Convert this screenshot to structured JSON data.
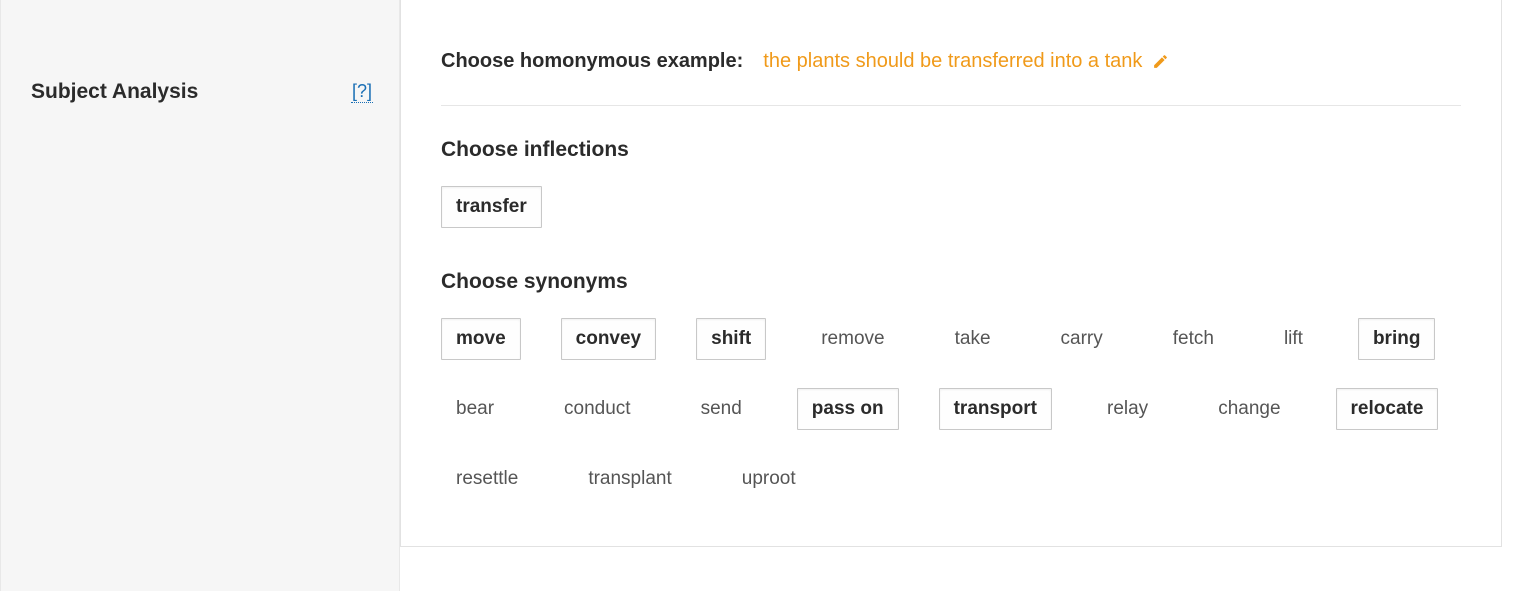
{
  "sidebar": {
    "title": "Subject Analysis",
    "help_label": "[?]"
  },
  "example": {
    "label": "Choose homonymous example:",
    "text": "the plants should be transferred into a tank"
  },
  "inflections": {
    "heading": "Choose inflections",
    "items": [
      "transfer"
    ],
    "selected": [
      "transfer"
    ]
  },
  "synonyms": {
    "heading": "Choose synonyms",
    "items": [
      "move",
      "convey",
      "shift",
      "remove",
      "take",
      "carry",
      "fetch",
      "lift",
      "bring",
      "bear",
      "conduct",
      "send",
      "pass on",
      "transport",
      "relay",
      "change",
      "relocate",
      "resettle",
      "transplant",
      "uproot"
    ],
    "selected": [
      "move",
      "convey",
      "shift",
      "bring",
      "pass on",
      "transport",
      "relocate"
    ]
  }
}
